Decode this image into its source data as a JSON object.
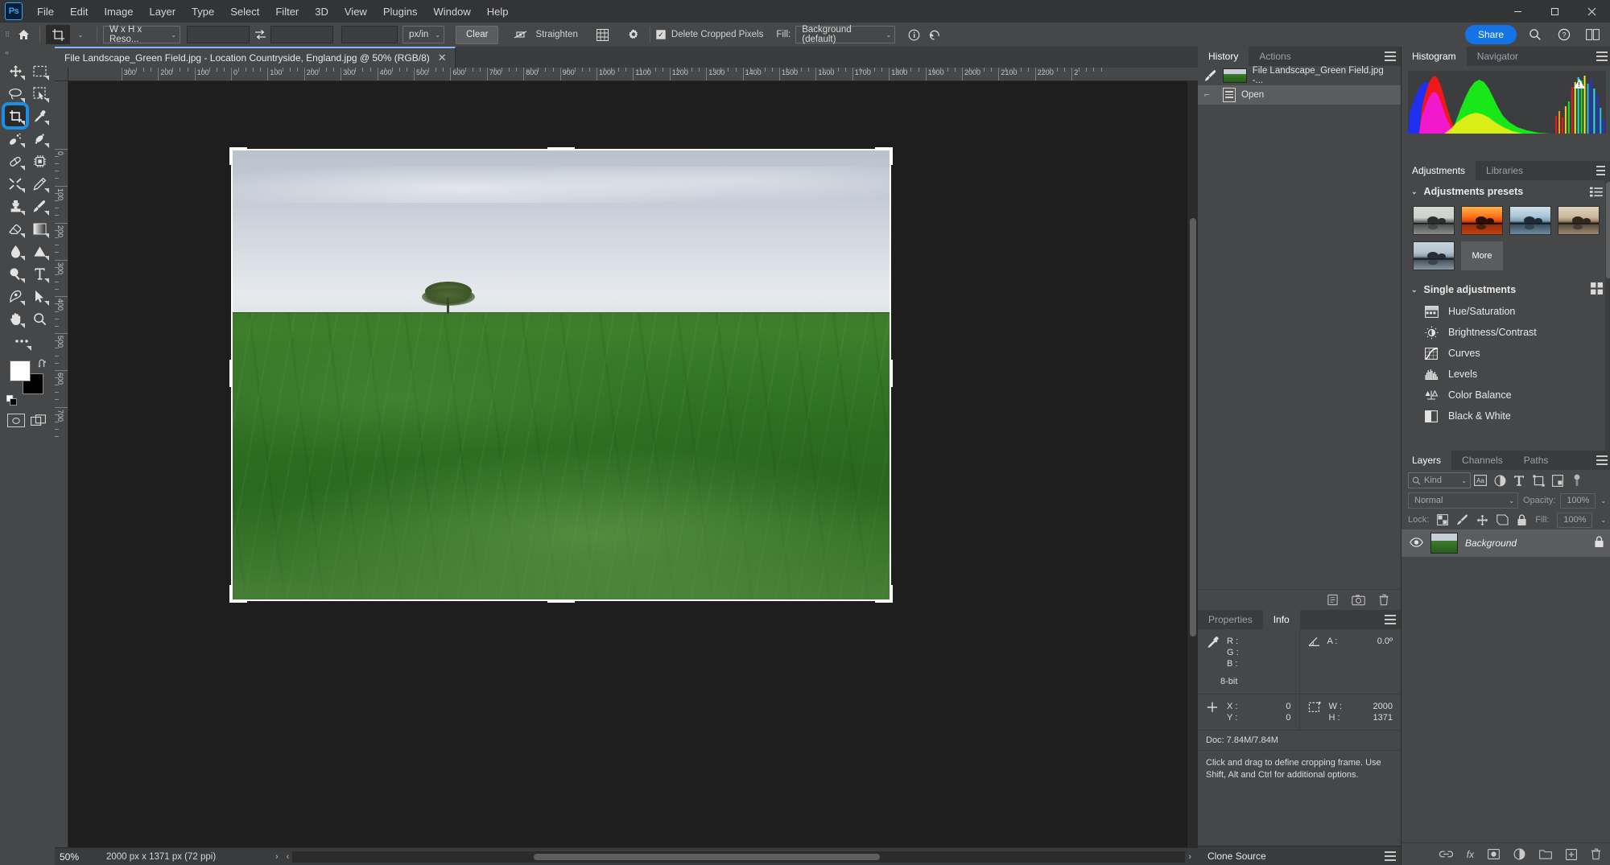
{
  "app": {
    "name": "Adobe Photoshop",
    "logo_text": "Ps"
  },
  "menubar": {
    "items": [
      "File",
      "Edit",
      "Image",
      "Layer",
      "Type",
      "Select",
      "Filter",
      "3D",
      "View",
      "Plugins",
      "Window",
      "Help"
    ],
    "window_controls": {
      "minimize": "─",
      "maximize": "☐",
      "close": "✕"
    }
  },
  "options_bar": {
    "home_icon": "home-icon",
    "tool_icon": "crop-tool-icon",
    "ratio_select": "W x H x Reso...",
    "width_value": "",
    "height_value": "",
    "resolution_value": "",
    "swap_icon": "swap-arrows-icon",
    "unit_select": "px/in",
    "clear_label": "Clear",
    "straighten_icon": "straighten-icon",
    "straighten_label": "Straighten",
    "overlay_icon": "grid-overlay-icon",
    "settings_icon": "gear-icon",
    "delete_cropped_label": "Delete Cropped Pixels",
    "delete_cropped_checked": true,
    "fill_label": "Fill:",
    "fill_select": "Background (default)",
    "info_icon": "info-circle-icon",
    "reset_icon": "reset-arrow-icon",
    "share_label": "Share",
    "search_icon": "search-icon",
    "help_icon": "help-circle-icon",
    "workspace_icon": "workspace-icon"
  },
  "toolbar": {
    "collapse_icon": "collapse-chevrons-icon",
    "tools": [
      {
        "name": "move-tool",
        "glyph": "move"
      },
      {
        "name": "rectangular-marquee-tool",
        "glyph": "marquee"
      },
      {
        "name": "lasso-tool",
        "glyph": "lasso"
      },
      {
        "name": "object-selection-tool",
        "glyph": "objsel"
      },
      {
        "name": "crop-tool",
        "glyph": "crop",
        "active": true,
        "highlighted": true
      },
      {
        "name": "eyedropper-tool",
        "glyph": "eyedrop"
      },
      {
        "name": "spot-healing-brush-tool",
        "glyph": "heal"
      },
      {
        "name": "patch-tool",
        "glyph": "patch"
      },
      {
        "name": "remove-tool",
        "glyph": "remove"
      },
      {
        "name": "neural-filters-tool",
        "glyph": "chip"
      },
      {
        "name": "smart-fix-tool",
        "glyph": "scissors"
      },
      {
        "name": "pencil-tool",
        "glyph": "pencil"
      },
      {
        "name": "clone-stamp-tool",
        "glyph": "stamp"
      },
      {
        "name": "brush-tool",
        "glyph": "brush"
      },
      {
        "name": "eraser-tool",
        "glyph": "eraser"
      },
      {
        "name": "gradient-tool",
        "glyph": "gradient"
      },
      {
        "name": "blur-tool",
        "glyph": "drop"
      },
      {
        "name": "dodge-tool",
        "glyph": "triangle"
      },
      {
        "name": "burn-tool",
        "glyph": "dodge"
      },
      {
        "name": "type-tool",
        "glyph": "type"
      },
      {
        "name": "pen-tool",
        "glyph": "pen"
      },
      {
        "name": "path-selection-tool",
        "glyph": "arrow"
      },
      {
        "name": "hand-tool",
        "glyph": "hand"
      },
      {
        "name": "zoom-tool",
        "glyph": "zoom"
      },
      {
        "name": "edit-toolbar",
        "glyph": "dots"
      }
    ],
    "foreground_color": "#ffffff",
    "background_color": "#000000",
    "swap_icon": "swap-colors-icon",
    "default_colors_icon": "default-colors-icon",
    "quickmask_icon": "quick-mask-icon",
    "screenmode_icon": "screen-mode-icon"
  },
  "document": {
    "tab_title": "File Landscape_Green Field.jpg - Location Countryside, England.jpg @ 50% (RGB/8)",
    "close_icon": "close-icon",
    "ruler_h_labels": [
      "300",
      "200",
      "100",
      "0",
      "100",
      "200",
      "300",
      "400",
      "500",
      "600",
      "700",
      "800",
      "900",
      "1000",
      "1100",
      "1200",
      "1300",
      "1400",
      "1500",
      "1600",
      "1700",
      "1800",
      "1900",
      "2000",
      "2100",
      "2200",
      "2"
    ],
    "ruler_v_labels": [
      "0",
      "100",
      "200",
      "300",
      "400",
      "500",
      "600",
      "700"
    ]
  },
  "statusbar": {
    "zoom": "50%",
    "dimensions": "2000 px x 1371 px (72 ppi)",
    "next_icon": "chevron-right-icon",
    "prev_icon": "chevron-left-icon"
  },
  "history_panel": {
    "tabs": [
      {
        "label": "History",
        "active": true
      },
      {
        "label": "Actions",
        "active": false
      }
    ],
    "menu_icon": "panel-menu-icon",
    "states": [
      {
        "label": "File Landscape_Green Field.jpg -...",
        "icon": "snapshot-icon",
        "selected": false
      },
      {
        "label": "Open",
        "icon": "document-icon",
        "selected": true
      }
    ],
    "footer_icons": [
      "new-document-icon",
      "camera-snapshot-icon",
      "trash-icon"
    ]
  },
  "histogram_panel": {
    "tabs": [
      {
        "label": "Histogram",
        "active": true
      },
      {
        "label": "Navigator",
        "active": false
      }
    ],
    "menu_icon": "panel-menu-icon",
    "warning_icon": "cache-warning-icon"
  },
  "adjustments_panel": {
    "tabs": [
      {
        "label": "Adjustments",
        "active": true
      },
      {
        "label": "Libraries",
        "active": false
      }
    ],
    "menu_icon": "panel-menu-icon",
    "presets_section": {
      "title": "Adjustments presets",
      "expanded": true,
      "list_icon": "list-view-icon",
      "presets": [
        {
          "name": "preset-bw",
          "colors": [
            "#d6d8d4",
            "#9aa09c",
            "#3c4240"
          ]
        },
        {
          "name": "preset-sunset",
          "colors": [
            "#ff7a1a",
            "#e84a10",
            "#2a1208"
          ]
        },
        {
          "name": "preset-cool",
          "colors": [
            "#9fc1d8",
            "#6d93ad",
            "#24323c"
          ]
        },
        {
          "name": "preset-sepia",
          "colors": [
            "#cbb89b",
            "#9b866a",
            "#3a3127"
          ]
        },
        {
          "name": "preset-matte-blue",
          "colors": [
            "#b9c6cf",
            "#7d8d99",
            "#2e383e"
          ]
        }
      ],
      "more_label": "More"
    },
    "single_section": {
      "title": "Single adjustments",
      "expanded": true,
      "grid_icon": "grid-view-icon",
      "items": [
        {
          "label": "Hue/Saturation",
          "icon": "hue-saturation-icon"
        },
        {
          "label": "Brightness/Contrast",
          "icon": "brightness-contrast-icon"
        },
        {
          "label": "Curves",
          "icon": "curves-icon"
        },
        {
          "label": "Levels",
          "icon": "levels-icon"
        },
        {
          "label": "Color Balance",
          "icon": "color-balance-icon"
        },
        {
          "label": "Black & White",
          "icon": "black-white-icon"
        }
      ]
    }
  },
  "layers_panel": {
    "tabs": [
      {
        "label": "Layers",
        "active": true
      },
      {
        "label": "Channels",
        "active": false
      },
      {
        "label": "Paths",
        "active": false
      }
    ],
    "menu_icon": "panel-menu-icon",
    "filter": {
      "search_icon": "search-icon",
      "kind_label": "Kind",
      "icons": [
        "pixel-filter-icon",
        "adjustment-filter-icon",
        "type-filter-icon",
        "shape-filter-icon",
        "smart-object-filter-icon"
      ],
      "toggle_icon": "filter-toggle-icon"
    },
    "blend_mode": "Normal",
    "opacity_label": "Opacity:",
    "opacity_value": "100%",
    "lock_label": "Lock:",
    "lock_icons": [
      "lock-transparent-icon",
      "lock-image-icon",
      "lock-position-icon",
      "lock-artboard-icon",
      "lock-all-icon"
    ],
    "fill_label": "Fill:",
    "fill_value": "100%",
    "layers": [
      {
        "name": "Background",
        "visible": true,
        "locked": true,
        "selected": true,
        "visibility_icon": "eye-icon",
        "lock_icon": "lock-icon"
      }
    ],
    "footer_icons": [
      "link-layers-icon",
      "fx-icon",
      "layer-mask-icon",
      "adjustment-layer-icon",
      "new-group-icon",
      "new-layer-icon",
      "delete-layer-icon"
    ]
  },
  "info_panel": {
    "tabs": [
      {
        "label": "Properties",
        "active": false
      },
      {
        "label": "Info",
        "active": true
      }
    ],
    "menu_icon": "panel-menu-icon",
    "color_icon": "eyedropper-icon",
    "color_keys": [
      "R :",
      "G :",
      "B :"
    ],
    "color_values": [
      "",
      "",
      ""
    ],
    "bit_depth": "8-bit",
    "angle_icon": "angle-icon",
    "angle_key": "A :",
    "angle_value": "0.0º",
    "coord_icon": "crosshair-icon",
    "coord_keys": [
      "X :",
      "Y :"
    ],
    "coord_values": [
      "0",
      "0"
    ],
    "size_icon": "selection-size-icon",
    "size_keys": [
      "W :",
      "H :"
    ],
    "size_values": [
      "2000",
      "1371"
    ],
    "doc_label": "Doc: 7.84M/7.84M",
    "hint": "Click and drag to define cropping frame. Use Shift, Alt and Ctrl for additional options."
  },
  "clone_source_panel": {
    "label": "Clone Source",
    "menu_icon": "panel-menu-icon"
  },
  "colors": {
    "accent_blue": "#1473e6",
    "highlight_blue": "#1a8fe3",
    "panel_bg": "#454749",
    "panel_dark": "#393b3d",
    "canvas_bg": "#1e1e1e",
    "text": "#e8e8e8"
  }
}
